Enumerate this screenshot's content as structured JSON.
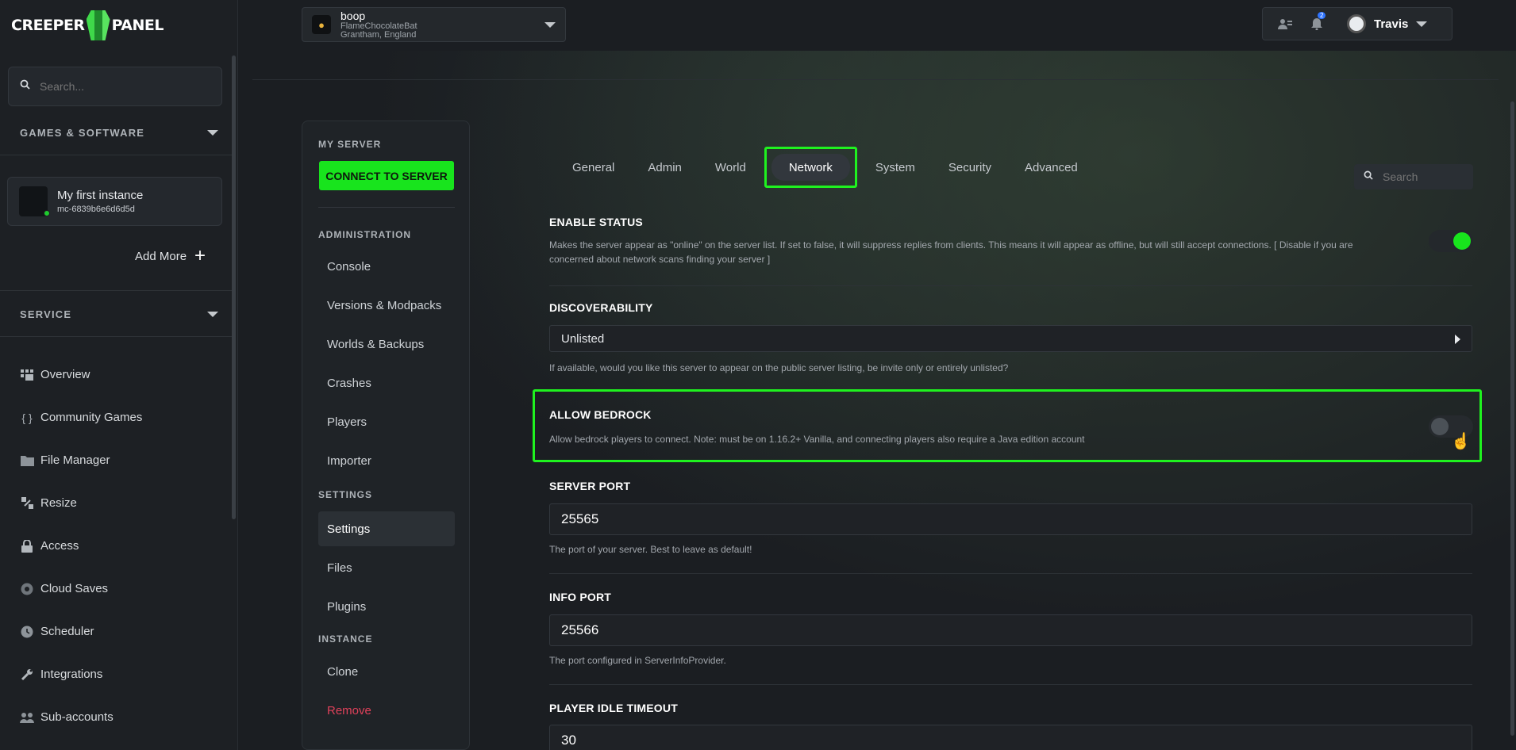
{
  "app": {
    "logo_left": "CREEPER",
    "logo_right": "PANEL"
  },
  "sidebar": {
    "search_placeholder": "Search...",
    "games_section": "GAMES & SOFTWARE",
    "instance": {
      "name": "My first instance",
      "id": "mc-6839b6e6d6d5d"
    },
    "add_more": "Add More",
    "service_section": "SERVICE",
    "items": [
      {
        "label": "Overview",
        "icon": "grid-icon"
      },
      {
        "label": "Community Games",
        "icon": "braces-icon"
      },
      {
        "label": "File Manager",
        "icon": "folder-icon"
      },
      {
        "label": "Resize",
        "icon": "resize-icon"
      },
      {
        "label": "Access",
        "icon": "lock-icon"
      },
      {
        "label": "Cloud Saves",
        "icon": "cloud-icon"
      },
      {
        "label": "Scheduler",
        "icon": "clock-icon"
      },
      {
        "label": "Integrations",
        "icon": "wrench-icon"
      },
      {
        "label": "Sub-accounts",
        "icon": "users-icon"
      }
    ]
  },
  "topbar": {
    "server_name": "boop",
    "server_user": "FlameChocolateBat",
    "server_location": "Grantham, England",
    "notification_count": "2",
    "username": "Travis"
  },
  "subnav": {
    "my_server": "MY SERVER",
    "connect": "CONNECT TO SERVER",
    "administration": "ADMINISTRATION",
    "admin_items": [
      "Console",
      "Versions & Modpacks",
      "Worlds & Backups",
      "Crashes",
      "Players",
      "Importer"
    ],
    "settings_head": "SETTINGS",
    "settings_items": [
      "Settings",
      "Files",
      "Plugins"
    ],
    "instance_head": "INSTANCE",
    "instance_items": [
      "Clone",
      "Remove"
    ]
  },
  "tabs": {
    "items": [
      "General",
      "Admin",
      "World",
      "Network",
      "System",
      "Security",
      "Advanced"
    ],
    "active": "Network",
    "search_placeholder": "Search"
  },
  "settings": {
    "enable_status": {
      "title": "ENABLE STATUS",
      "desc": "Makes the server appear as \"online\" on the server list. If set to false, it will suppress replies from clients. This means it will appear as offline, but will still accept connections. [ Disable if you are concerned about network scans finding your server ]",
      "enabled": true
    },
    "discoverability": {
      "title": "DISCOVERABILITY",
      "value": "Unlisted",
      "desc": "If available, would you like this server to appear on the public server listing, be invite only or entirely unlisted?"
    },
    "allow_bedrock": {
      "title": "ALLOW BEDROCK",
      "desc": "Allow bedrock players to connect. Note: must be on 1.16.2+ Vanilla, and connecting players also require a Java edition account",
      "enabled": false
    },
    "server_port": {
      "title": "SERVER PORT",
      "value": "25565",
      "desc": "The port of your server. Best to leave as default!"
    },
    "info_port": {
      "title": "INFO PORT",
      "value": "25566",
      "desc": "The port configured in ServerInfoProvider."
    },
    "player_idle_timeout": {
      "title": "PLAYER IDLE TIMEOUT",
      "value": "30"
    }
  },
  "colors": {
    "accent_green": "#18e41d",
    "highlight_green": "#1ff21f",
    "danger": "#e0415a",
    "badge_blue": "#2f74ff"
  }
}
